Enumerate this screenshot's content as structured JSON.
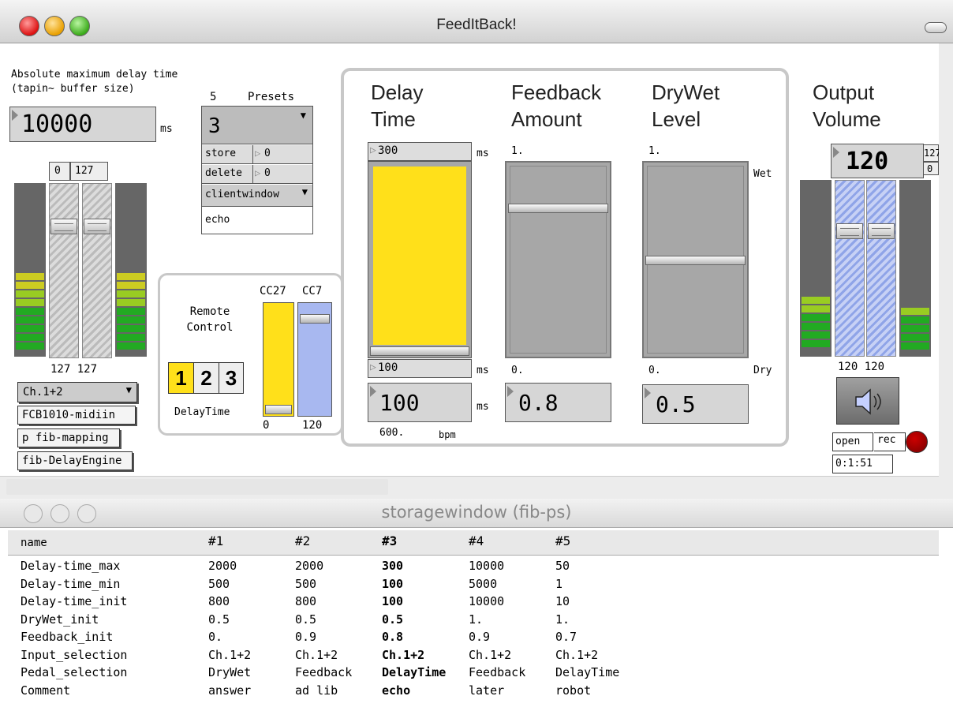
{
  "main_window": {
    "title": "FeedItBack!",
    "abs_max_label": "Absolute maximum delay time (tapin~ buffer size)",
    "abs_max_value": "10000",
    "abs_max_unit": "ms",
    "input_range_low": "0",
    "input_range_high": "127",
    "input_levels": "127 127",
    "input_select": "Ch.1+2",
    "midi_box": "FCB1010-midiin",
    "mapping_box": "p fib-mapping",
    "engine_box": "fib-DelayEngine",
    "presets": {
      "count": "5",
      "label": "Presets",
      "current": "3",
      "store_label": "store",
      "store_value": "0",
      "delete_label": "delete",
      "delete_value": "0",
      "client_label": "clientwindow",
      "comment": "echo"
    },
    "remote": {
      "title": "Remote Control",
      "cc1": "CC27",
      "cc2": "CC7",
      "btn1": "1",
      "btn2": "2",
      "btn3": "3",
      "mode": "DelayTime",
      "val1": "0",
      "val2": "120"
    },
    "delay": {
      "title": "Delay Time",
      "max": "300",
      "min": "100",
      "unit": "ms",
      "value": "100",
      "bpm_value": "600.",
      "bpm_unit": "bpm",
      "level": 1.0
    },
    "feedback": {
      "title": "Feedback Amount",
      "top": "1.",
      "bottom": "0.",
      "value": "0.8",
      "level": 0.8
    },
    "drywet": {
      "title": "DryWet Level",
      "top": "1.",
      "bottom": "0.",
      "wet": "Wet",
      "dry": "Dry",
      "value": "0.5",
      "level": 0.5
    },
    "output": {
      "title": "Output Volume",
      "value": "120",
      "max": "127",
      "min": "0",
      "levels": "120 120",
      "open_label": "open",
      "rec_label": "rec",
      "time": "0:1:51"
    }
  },
  "storage_window": {
    "title": "storagewindow (fib-ps)",
    "columns": [
      "name",
      "#1",
      "#2",
      "#3",
      "#4",
      "#5"
    ],
    "rows": [
      [
        "Delay-time_max",
        "2000",
        "2000",
        "300",
        "10000",
        "50"
      ],
      [
        "Delay-time_min",
        "500",
        "500",
        "100",
        "5000",
        "1"
      ],
      [
        "Delay-time_init",
        "800",
        "800",
        "100",
        "10000",
        "10"
      ],
      [
        "DryWet_init",
        "0.5",
        "0.5",
        "0.5",
        "1.",
        "1."
      ],
      [
        "Feedback_init",
        "0.",
        "0.9",
        "0.8",
        "0.9",
        "0.7"
      ],
      [
        "Input_selection",
        "Ch.1+2",
        "Ch.1+2",
        "Ch.1+2",
        "Ch.1+2",
        "Ch.1+2"
      ],
      [
        "Pedal_selection",
        "DryWet",
        "Feedback",
        "DelayTime",
        "Feedback",
        "DelayTime"
      ],
      [
        "Comment",
        "answer",
        "ad lib",
        "echo",
        "later",
        "robot"
      ]
    ]
  },
  "colors": {
    "yellow": "#ffe01a",
    "blue": "#a8b8f0",
    "meter_green": "#22aa22",
    "meter_yellow": "#cccc22",
    "rec_red": "#aa0000"
  }
}
